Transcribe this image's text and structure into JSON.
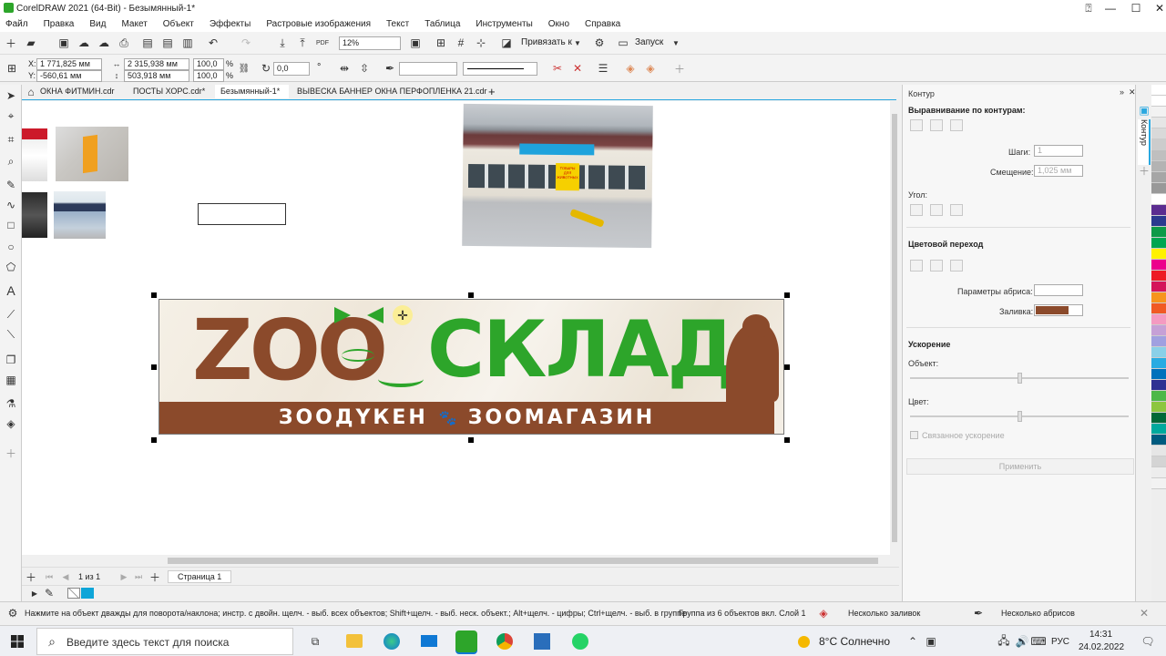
{
  "window": {
    "title": "CorelDRAW 2021 (64-Bit) - Безымянный-1*",
    "minimize": "—",
    "maximize": "☐",
    "close": "✕",
    "help": "⍰"
  },
  "menu": [
    "Файл",
    "Правка",
    "Вид",
    "Макет",
    "Объект",
    "Эффекты",
    "Растровые изображения",
    "Текст",
    "Таблица",
    "Инструменты",
    "Окно",
    "Справка"
  ],
  "toolbar": {
    "zoom": "12%",
    "snap": "Привязать к",
    "launch": "Запуск",
    "pdf": "PDF"
  },
  "props": {
    "x": "1 771,825 мм",
    "y": "-560,61 мм",
    "w": "2 315,938 мм",
    "h": "503,918 мм",
    "sx": "100,0",
    "sy": "100,0",
    "pct": "%",
    "angle": "0,0",
    "deg": "°"
  },
  "tabs": [
    "ОКНА ФИТМИН.cdr",
    "ПОСТЫ ХОРС.cdr*",
    "Безымянный-1*",
    "ВЫВЕСКА БАННЕР ОКНА ПЕРФОПЛЕНКА 21.cdr"
  ],
  "tab_add": "+",
  "banner": {
    "zoo": "ZOO",
    "sklad": "СКЛАД",
    "sub_left": "ЗООДҮКЕН",
    "sub_right": "ЗООМАГАЗИН",
    "paw": "🐾"
  },
  "shop_sign": "ТОВАРЫ ДЛЯ ЖИВОТНЫХ",
  "pager": {
    "count": "1 из 1",
    "page": "Страница 1"
  },
  "docker": {
    "title": "Контур",
    "align": "Выравнивание по контурам:",
    "steps_label": "Шаги:",
    "steps_value": "1",
    "offset_label": "Смещение:",
    "offset_value": "1,025 мм",
    "corner": "Угол:",
    "blend": "Цветовой переход",
    "outline_params": "Параметры абриса:",
    "fill_label": "Заливка:",
    "fill_color": "#8b4a2b",
    "accel": "Ускорение",
    "object": "Объект:",
    "color": "Цвет:",
    "linked": "Связанное ускорение",
    "apply": "Применить",
    "vertical_tab": "Контур"
  },
  "status": {
    "hint": "Нажмите на объект дважды для поворота/наклона; инстр. с двойн. щелч. - выб. всех объектов; Shift+щелч. - выб. неск. объект.; Alt+щелч. - цифры; Ctrl+щелч. - выб. в группе",
    "group": "Группа из 6 объектов вкл. Слой 1",
    "fills": "Несколько заливок",
    "outlines": "Несколько абрисов"
  },
  "taskbar": {
    "search": "Введите здесь текст для поиска",
    "weather": "8°C Солнечно",
    "lang": "РУС",
    "time": "14:31",
    "date": "24.02.2022"
  },
  "palette": [
    "#ffffff",
    "#ffffff",
    "#f2f2f2",
    "#e6e6e6",
    "#d9d9d9",
    "#cccccc",
    "#bfbfbf",
    "#b3b3b3",
    "#a6a6a6",
    "#999999",
    "#ffffff",
    "#5b2d90",
    "#2b3a8f",
    "#0e9a48",
    "#00a650",
    "#fff200",
    "#ec008c",
    "#ed1c24",
    "#d4145a",
    "#f7941d",
    "#f15a24",
    "#f49ac1",
    "#c6a0d6",
    "#a0a0e0",
    "#8ad0e8",
    "#29abe2",
    "#0071bc",
    "#2e3192",
    "#4db848",
    "#8dc63f",
    "#006838",
    "#00a99d",
    "#005b7f",
    "#e6e6e6",
    "#d4d4d4",
    "#ededed",
    "#f2f2f2"
  ],
  "colors": {
    "accent": "#29a8e0",
    "brown": "#8b4a2b",
    "green": "#2da52a"
  }
}
